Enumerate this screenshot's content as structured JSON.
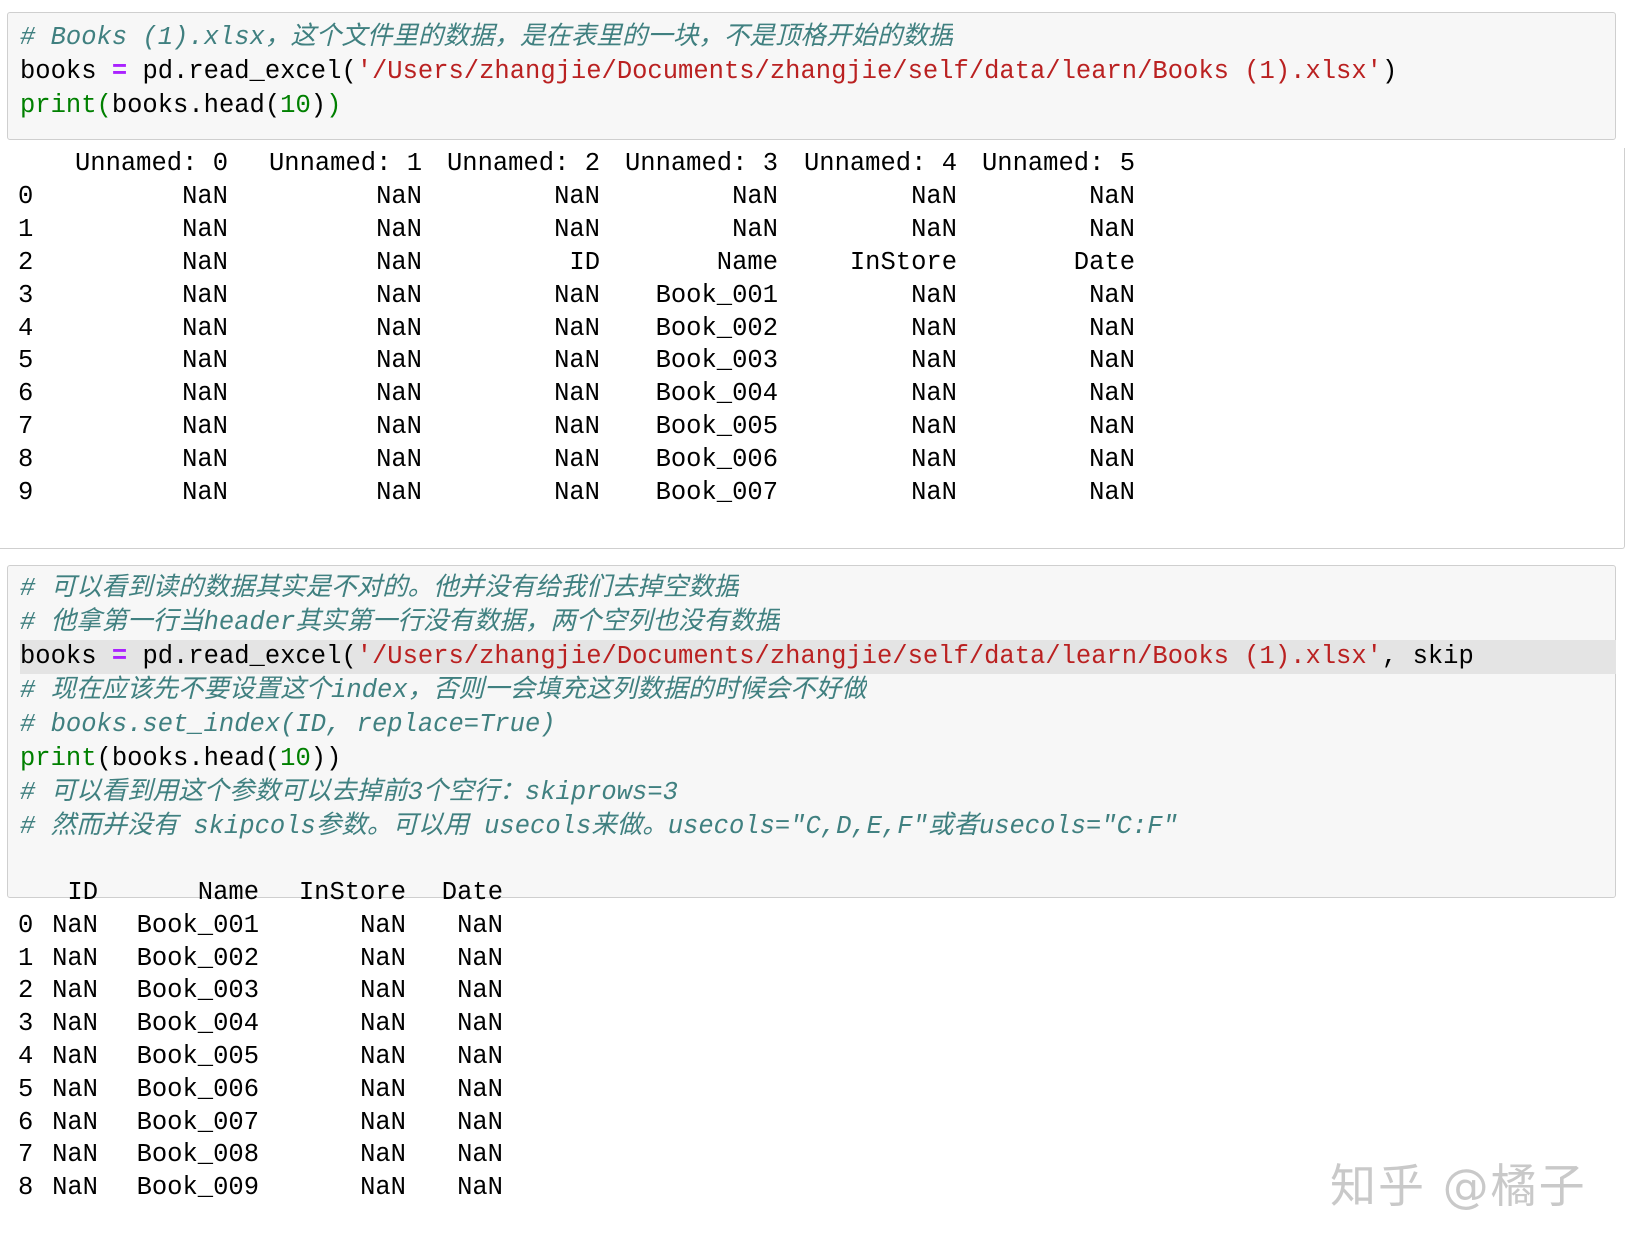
{
  "cell1": {
    "comment": "# Books (1).xlsx，这个文件里的数据，是在表里的一块，不是顶格开始的数据",
    "code_var": "books ",
    "code_eq": "=",
    "code_call": " pd.read_excel(",
    "code_str": "'/Users/zhangjie/Documents/zhangjie/self/data/learn/Books (1).xlsx'",
    "code_close": ")",
    "print_kw": "print",
    "print_open": "(",
    "print_body": "books.head(",
    "print_num": "10",
    "print_close1": ")",
    "print_close2": ")"
  },
  "output1": {
    "header": [
      "Unnamed: 0",
      "Unnamed: 1",
      "Unnamed: 2",
      "Unnamed: 3",
      "Unnamed: 4",
      "Unnamed: 5"
    ],
    "rows": [
      {
        "index": "0",
        "cells": [
          "NaN",
          "NaN",
          "NaN",
          "NaN",
          "NaN",
          "NaN"
        ]
      },
      {
        "index": "1",
        "cells": [
          "NaN",
          "NaN",
          "NaN",
          "NaN",
          "NaN",
          "NaN"
        ]
      },
      {
        "index": "2",
        "cells": [
          "NaN",
          "NaN",
          "ID",
          "Name",
          "InStore",
          "Date"
        ]
      },
      {
        "index": "3",
        "cells": [
          "NaN",
          "NaN",
          "NaN",
          "Book_001",
          "NaN",
          "NaN"
        ]
      },
      {
        "index": "4",
        "cells": [
          "NaN",
          "NaN",
          "NaN",
          "Book_002",
          "NaN",
          "NaN"
        ]
      },
      {
        "index": "5",
        "cells": [
          "NaN",
          "NaN",
          "NaN",
          "Book_003",
          "NaN",
          "NaN"
        ]
      },
      {
        "index": "6",
        "cells": [
          "NaN",
          "NaN",
          "NaN",
          "Book_004",
          "NaN",
          "NaN"
        ]
      },
      {
        "index": "7",
        "cells": [
          "NaN",
          "NaN",
          "NaN",
          "Book_005",
          "NaN",
          "NaN"
        ]
      },
      {
        "index": "8",
        "cells": [
          "NaN",
          "NaN",
          "NaN",
          "Book_006",
          "NaN",
          "NaN"
        ]
      },
      {
        "index": "9",
        "cells": [
          "NaN",
          "NaN",
          "NaN",
          "Book_007",
          "NaN",
          "NaN"
        ]
      }
    ]
  },
  "cell2": {
    "comment1": "# 可以看到读的数据其实是不对的。他并没有给我们去掉空数据",
    "comment2": "# 他拿第一行当header其实第一行没有数据，两个空列也没有数据",
    "code_var": "books ",
    "code_eq": "=",
    "code_call": " pd.read_excel(",
    "code_str": "'/Users/zhangjie/Documents/zhangjie/self/data/learn/Books (1).xlsx'",
    "code_rest": ", skip",
    "comment3": "# 现在应该先不要设置这个index，否则一会填充这列数据的时候会不好做",
    "comment4": "# books.set_index(ID, replace=True)",
    "print_kw": "print",
    "print_body": "(books.head(",
    "print_num": "10",
    "print_close": "))",
    "comment5": "# 可以看到用这个参数可以去掉前3个空行：skiprows=3",
    "comment6": "# 然而并没有 skipcols参数。可以用 usecols来做。usecols=\"C,D,E,F\"或者usecols=\"C:F\""
  },
  "output2": {
    "header": [
      "ID",
      "Name",
      "InStore",
      "Date"
    ],
    "rows": [
      {
        "index": "0",
        "cells": [
          "NaN",
          "Book_001",
          "NaN",
          "NaN"
        ]
      },
      {
        "index": "1",
        "cells": [
          "NaN",
          "Book_002",
          "NaN",
          "NaN"
        ]
      },
      {
        "index": "2",
        "cells": [
          "NaN",
          "Book_003",
          "NaN",
          "NaN"
        ]
      },
      {
        "index": "3",
        "cells": [
          "NaN",
          "Book_004",
          "NaN",
          "NaN"
        ]
      },
      {
        "index": "4",
        "cells": [
          "NaN",
          "Book_005",
          "NaN",
          "NaN"
        ]
      },
      {
        "index": "5",
        "cells": [
          "NaN",
          "Book_006",
          "NaN",
          "NaN"
        ]
      },
      {
        "index": "6",
        "cells": [
          "NaN",
          "Book_007",
          "NaN",
          "NaN"
        ]
      },
      {
        "index": "7",
        "cells": [
          "NaN",
          "Book_008",
          "NaN",
          "NaN"
        ]
      },
      {
        "index": "8",
        "cells": [
          "NaN",
          "Book_009",
          "NaN",
          "NaN"
        ]
      }
    ]
  },
  "watermark": "知乎 @橘子"
}
